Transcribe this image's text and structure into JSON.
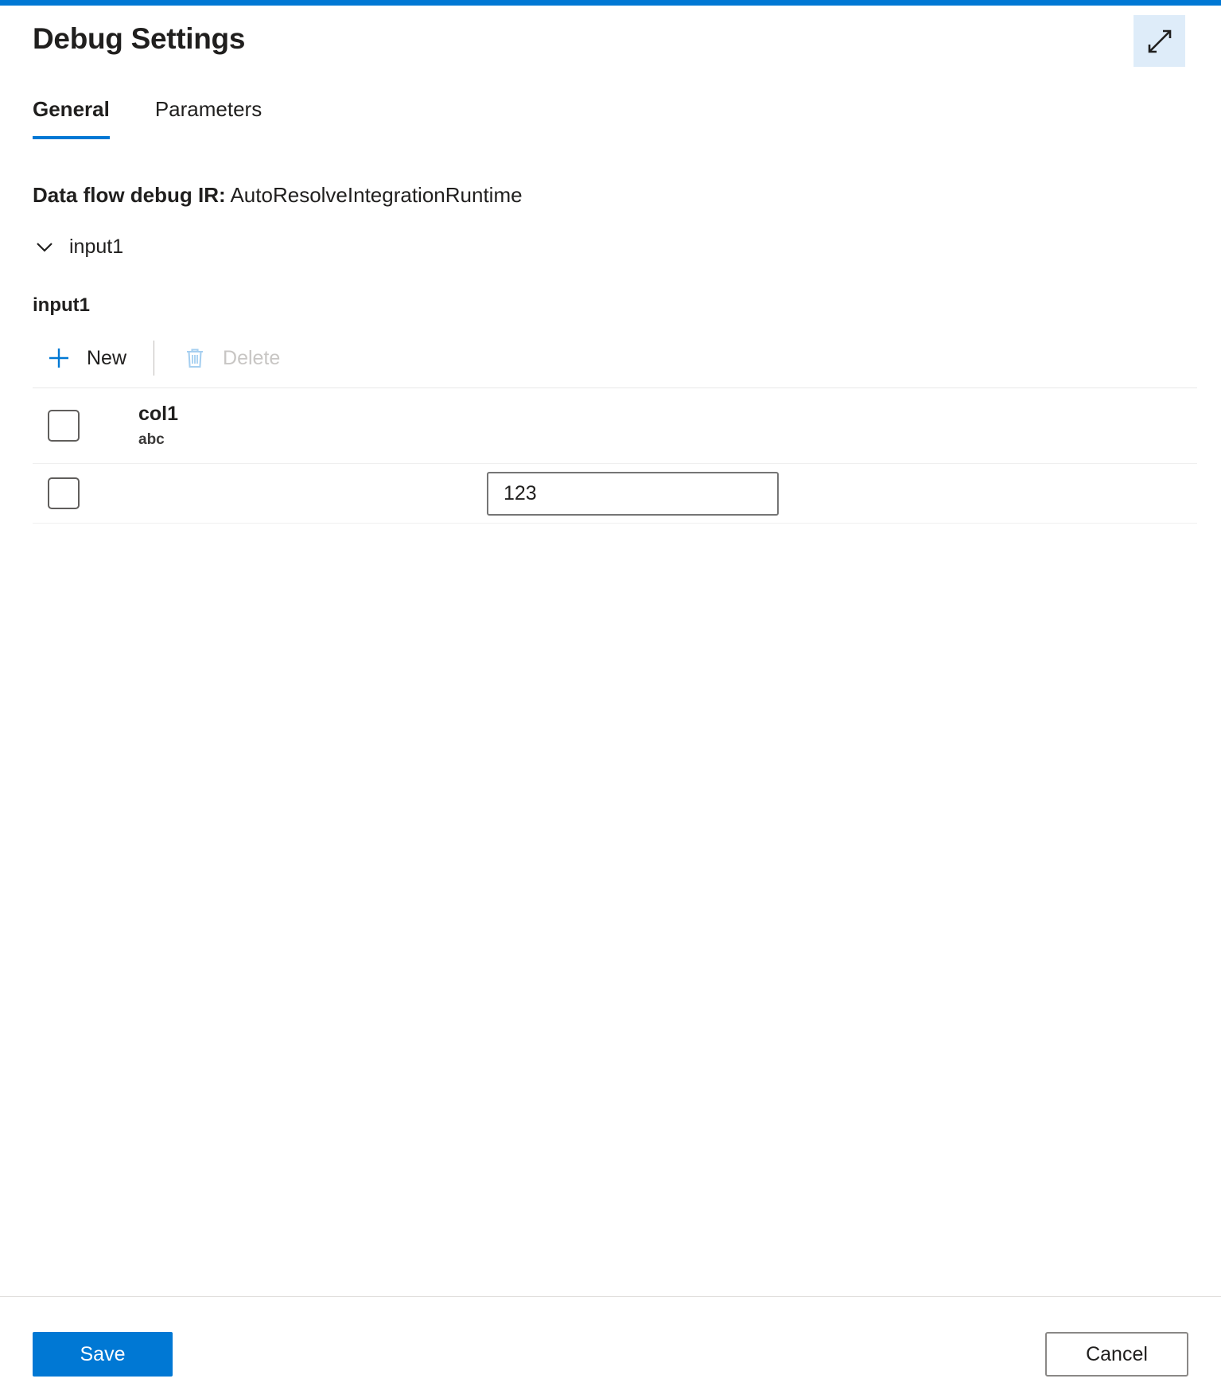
{
  "window": {
    "title": "Debug Settings",
    "accent_color": "#0078d4",
    "expand_icon": "expand-diagonal-icon"
  },
  "tabs": [
    {
      "label": "General",
      "selected": true
    },
    {
      "label": "Parameters",
      "selected": false
    }
  ],
  "general": {
    "ir_label": "Data flow debug IR:",
    "ir_value": "AutoResolveIntegrationRuntime",
    "stream_toggle": {
      "label": "input1",
      "icon": "chevron-down-icon",
      "expanded": true
    },
    "source_name": "input1",
    "toolbar": {
      "new_label": "New",
      "new_icon": "plus-icon",
      "delete_label": "Delete",
      "delete_icon": "trash-icon",
      "delete_disabled": true
    },
    "grid": {
      "columns": [
        {
          "name": "col1",
          "type": "abc"
        }
      ],
      "rows": [
        {
          "value": "123"
        }
      ]
    }
  },
  "footer": {
    "save_label": "Save",
    "cancel_label": "Cancel"
  }
}
